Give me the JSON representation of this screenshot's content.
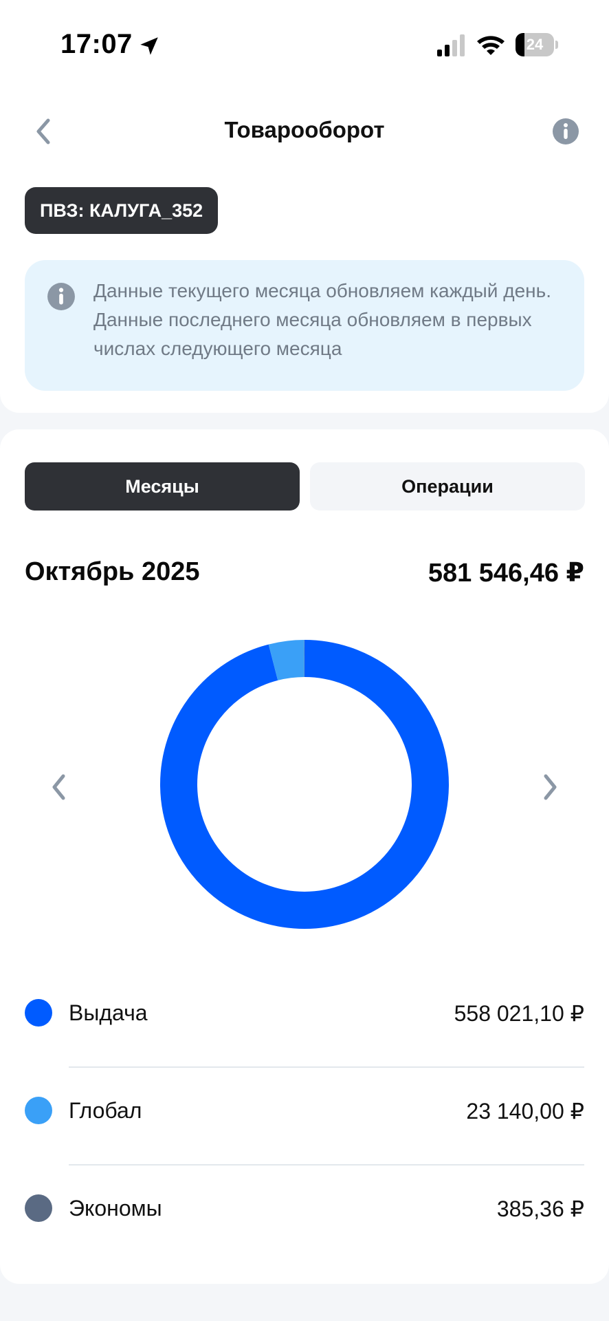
{
  "status_bar": {
    "time": "17:07",
    "battery": "24",
    "battery_level": 0.24
  },
  "header": {
    "title": "Товарооборот"
  },
  "pvz": {
    "label": "ПВЗ: КАЛУГА_352"
  },
  "notice": {
    "text": "Данные текущего месяца обновляем каждый день. Данные последнего месяца обновляем в первых числах следующего месяца"
  },
  "tabs": [
    {
      "label": "Месяцы",
      "active": true
    },
    {
      "label": "Операции",
      "active": false
    }
  ],
  "summary": {
    "period": "Октябрь 2025",
    "total": "581 546,46 ₽"
  },
  "colors": {
    "dark": "#2f3136",
    "accent": "#005bff",
    "light_blue": "#3aa0f7",
    "slate": "#5a6a83",
    "notice_bg": "#e6f4fd"
  },
  "icons": {
    "back": "chevron-left-icon",
    "info": "info-icon",
    "prev": "chevron-left-icon",
    "next": "chevron-right-icon"
  },
  "chart_data": {
    "type": "pie",
    "labels": [
      "Выдача",
      "Глобал",
      "Экономы"
    ],
    "values": [
      558021.1,
      23140.0,
      385.36
    ],
    "display_values": [
      "558 021,10 ₽",
      "23 140,00 ₽",
      "385,36 ₽"
    ],
    "colors": [
      "#005bff",
      "#3aa0f7",
      "#5a6a83"
    ],
    "total": "581 546,46 ₽"
  }
}
